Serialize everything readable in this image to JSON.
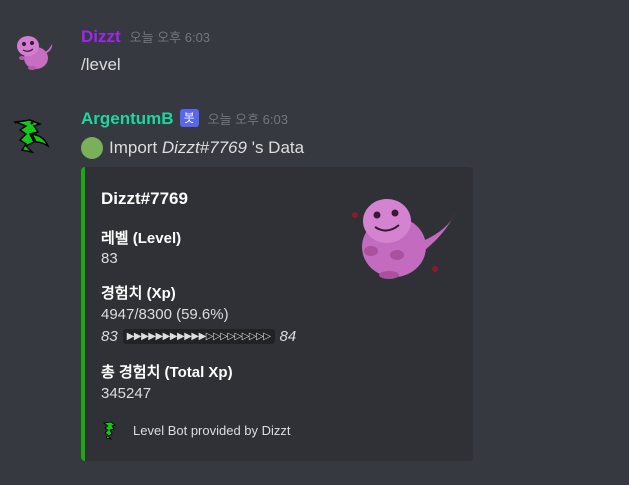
{
  "messages": [
    {
      "author": "Dizzt",
      "author_color": "#a224f0",
      "timestamp": "오늘 오후 6:03",
      "content": "/level"
    },
    {
      "author": "ArgentumB",
      "author_color": "#1ed79e",
      "bot_badge": "봇",
      "timestamp": "오늘 오후 6:03",
      "content": {
        "emoji": "green-circle",
        "prefix": "Import ",
        "user_tag": "Dizzt#7769",
        "suffix": " 's Data"
      },
      "embed": {
        "accent_color": "#1ba810",
        "title": "Dizzt#7769",
        "fields": [
          {
            "name": "레벨 (Level)",
            "value": "83"
          },
          {
            "name": "경험치 (Xp)",
            "value": "4947/8300 (59.6%)"
          },
          {
            "name": "총 경험치 (Total Xp)",
            "value": "345247"
          }
        ],
        "progress": {
          "current_level": "83",
          "bar": "▶▶▶▶▶▶▶▶▶▶▶▷▷▷▷▷▷▷▷▷",
          "next_level": "84",
          "fraction": 0.596
        },
        "footer": "Level Bot provided by Dizzt",
        "thumbnail": "pink-blob-creature"
      }
    }
  ]
}
